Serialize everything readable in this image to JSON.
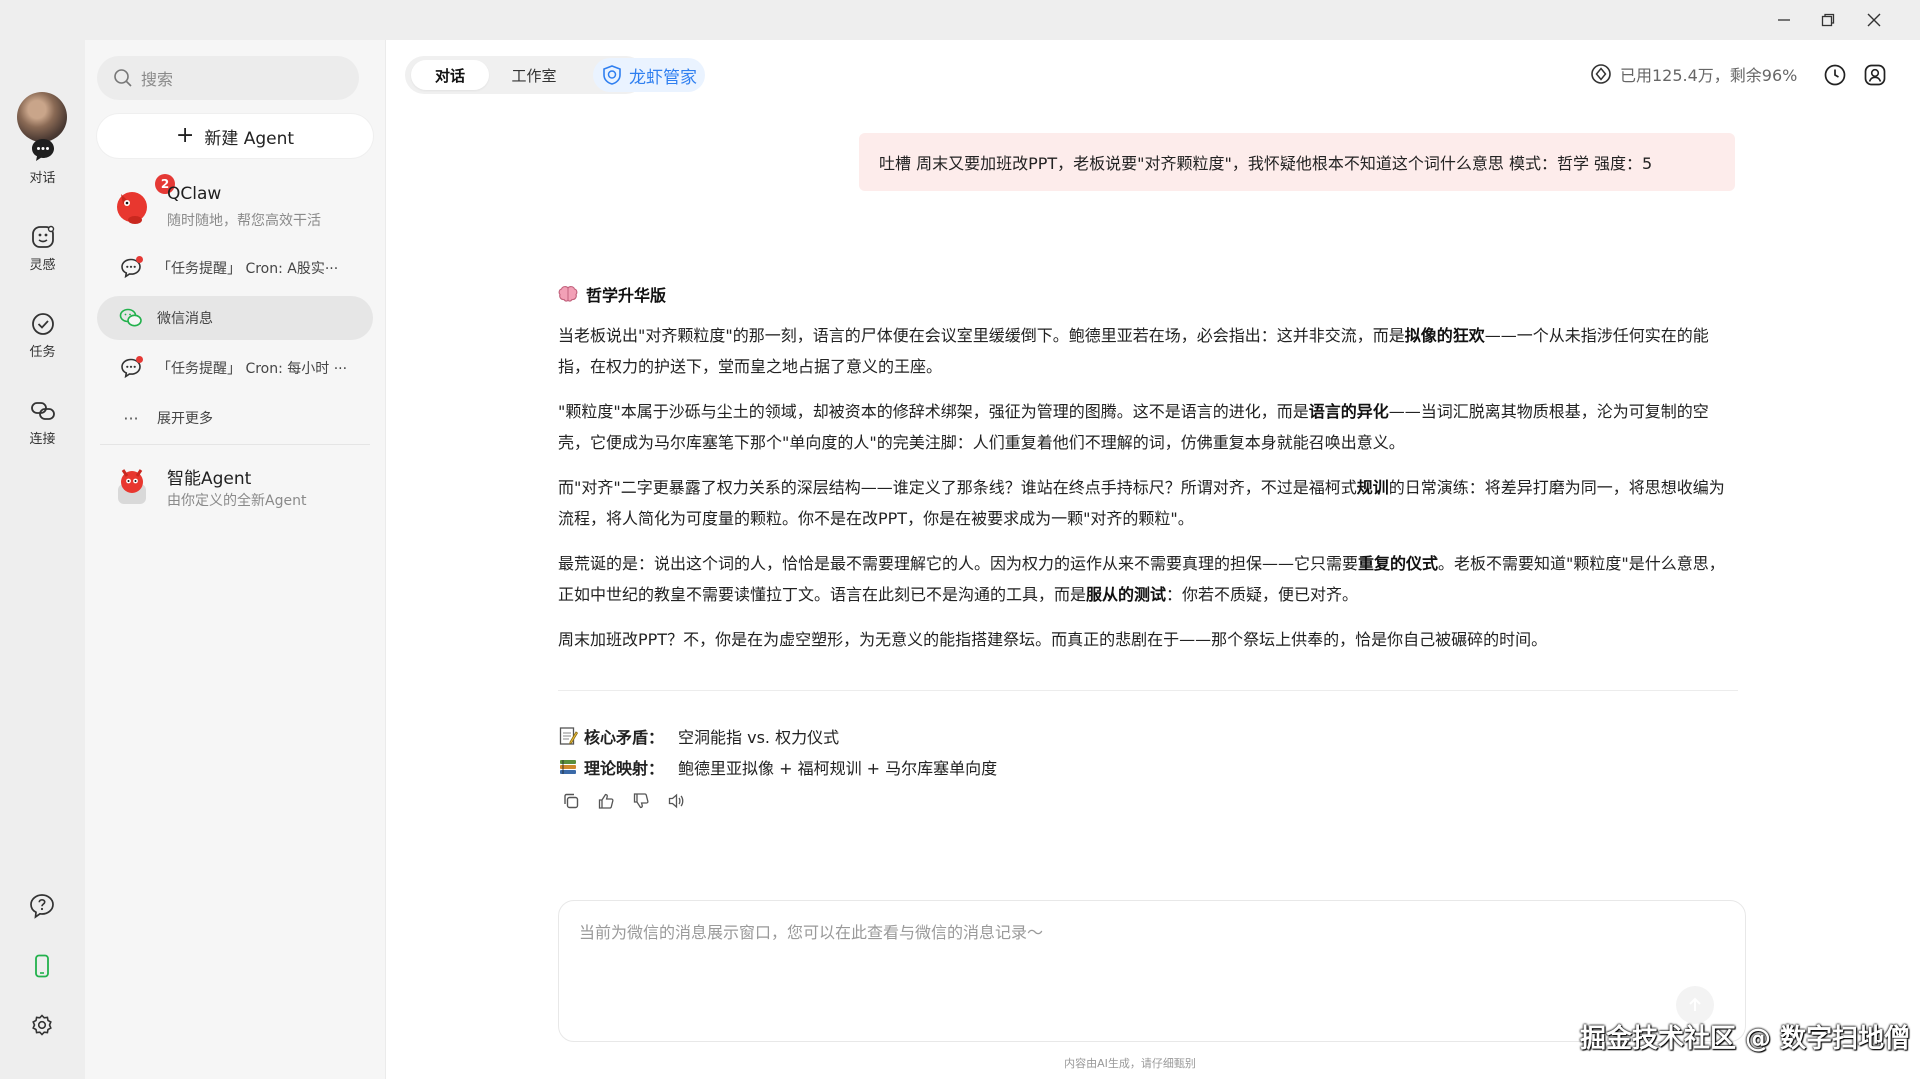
{
  "window": {
    "minimize": "—",
    "restore": "❐",
    "close": "✕"
  },
  "rail": {
    "items": [
      {
        "label": "对话",
        "icon": "chat-bubble-icon"
      },
      {
        "label": "灵感",
        "icon": "inspiration-icon"
      },
      {
        "label": "任务",
        "icon": "task-check-icon"
      },
      {
        "label": "连接",
        "icon": "link-icon"
      }
    ],
    "bottom_icons": [
      "help-icon",
      "phone-icon",
      "settings-icon"
    ]
  },
  "sidebar": {
    "search_placeholder": "搜索",
    "new_agent_label": "新建 Agent",
    "qclaw": {
      "name": "QClaw",
      "subtitle": "随时随地，帮您高效干活",
      "badge": "2"
    },
    "items": [
      {
        "label": "「任务提醒」 Cron: A股实···",
        "icon": "chat-icon",
        "unread": true
      },
      {
        "label": "微信消息",
        "icon": "wechat-icon",
        "active": true
      },
      {
        "label": "「任务提醒」 Cron: 每小时 ···",
        "icon": "chat-icon",
        "unread": true
      },
      {
        "label": "展开更多",
        "icon": "more-icon"
      }
    ],
    "smart_agent": {
      "name": "智能Agent",
      "subtitle": "由你定义的全新Agent"
    }
  },
  "header": {
    "tabs": [
      "对话",
      "工作室"
    ],
    "active_tab": "对话",
    "butler_label": "龙虾管家",
    "usage_text": "已用125.4万，剩余96%"
  },
  "chat": {
    "user_message": "吐槽 周末又要加班改PPT，老板说要\"对齐颗粒度\"，我怀疑他根本不知道这个词什么意思 模式：哲学 强度：5",
    "answer_title": "哲学升华版",
    "paragraphs": [
      {
        "p1": "当老板说出\"对齐颗粒度\"的那一刻，语言的尸体便在会议室里缓缓倒下。鲍德里亚若在场，必会指出：这并非交流，而是",
        "b1": "拟像的狂欢",
        "p2": "——一个从未指涉任何实在的能指，在权力的护送下，堂而皇之地占据了意义的王座。"
      },
      {
        "p1": "\"颗粒度\"本属于沙砾与尘土的领域，却被资本的修辞术绑架，强征为管理的图腾。这不是语言的进化，而是",
        "b1": "语言的异化",
        "p2": "——当词汇脱离其物质根基，沦为可复制的空壳，它便成为马尔库塞笔下那个\"单向度的人\"的完美注脚：人们重复着他们不理解的词，仿佛重复本身就能召唤出意义。"
      },
      {
        "p1": "而\"对齐\"二字更暴露了权力关系的深层结构——谁定义了那条线？谁站在终点手持标尺？所谓对齐，不过是福柯式",
        "b1": "规训",
        "p2": "的日常演练：将差异打磨为同一，将思想收编为流程，将人简化为可度量的颗粒。你不是在改PPT，你是在被要求成为一颗\"对齐的颗粒\"。"
      },
      {
        "p1": "最荒诞的是：说出这个词的人，恰恰是最不需要理解它的人。因为权力的运作从来不需要真理的担保——它只需要",
        "b1": "重复的仪式",
        "p2": "。老板不需要知道\"颗粒度\"是什么意思，正如中世纪的教皇不需要读懂拉丁文。语言在此刻已不是沟通的工具，而是",
        "b2": "服从的测试",
        "p3": "：你若不质疑，便已对齐。"
      },
      {
        "p1": "周末加班改PPT？不，你是在为虚空塑形，为无意义的能指搭建祭坛。而真正的悲剧在于——那个祭坛上供奉的，恰是你自己被碾碎的时间。"
      }
    ],
    "core_conflict_label": "核心矛盾：",
    "core_conflict_value": "空洞能指 vs. 权力仪式",
    "theory_label": "理论映射：",
    "theory_value": "鲍德里亚拟像 + 福柯规训 + 马尔库塞单向度",
    "action_icons": [
      "copy-icon",
      "thumbs-up-icon",
      "thumbs-down-icon",
      "speaker-icon"
    ]
  },
  "input": {
    "placeholder": "当前为微信的消息展示窗口，您可以在此查看与微信的消息记录～"
  },
  "disclaimer": "内容由AI生成，请仔细甄别",
  "watermark": "掘金技术社区 @ 数字扫地僧",
  "colors": {
    "accent": "#2f7ff0",
    "bubble": "#fdeceb",
    "badge": "#e53935",
    "wechat": "#22b14c"
  }
}
